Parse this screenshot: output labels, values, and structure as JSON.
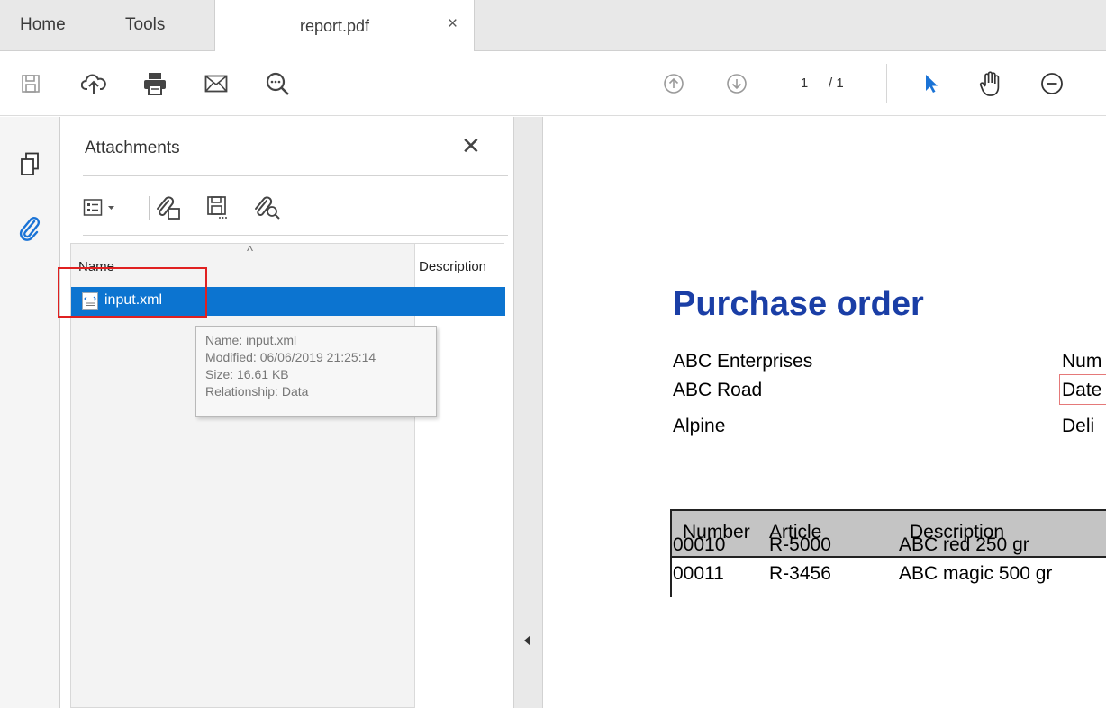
{
  "tabs": {
    "home": "Home",
    "tools": "Tools",
    "document": "report.pdf",
    "close": "×"
  },
  "toolbar": {
    "icons": [
      "save-icon",
      "cloud-upload-icon",
      "print-icon",
      "mail-icon",
      "zoom-search-icon",
      "page-up-icon",
      "page-down-icon",
      "select-arrow-icon",
      "hand-icon",
      "zoom-out-icon"
    ],
    "page_current": "1",
    "page_total": "/ 1",
    "accent_color": "#1a73d6"
  },
  "rail": {
    "icons": [
      "page-thumbnails-icon",
      "attachment-paperclip-icon"
    ]
  },
  "attachments": {
    "title": "Attachments",
    "close": "✕",
    "tools": [
      "options-icon",
      "add-attachment-icon",
      "save-attachment-icon",
      "search-attachment-icon"
    ],
    "columns": {
      "name": "Name",
      "description": "Description"
    },
    "rows": [
      {
        "name": "input.xml",
        "selected": true
      }
    ],
    "selection_color": "#0c74d0",
    "tooltip": {
      "name": "Name: input.xml",
      "modified": "Modified: 06/06/2019 21:25:14",
      "size": "Size: 16.61 KB",
      "relationship": "Relationship: Data"
    }
  },
  "document": {
    "title": "Purchase order",
    "title_color": "#1a3ea6",
    "address": [
      "ABC Enterprises",
      "ABC Road",
      "Alpine"
    ],
    "right_labels": [
      "Num",
      "Date",
      "Deli"
    ],
    "table": {
      "headers": [
        "Number",
        "Article",
        "Description"
      ],
      "rows": [
        [
          "00010",
          "R-5000",
          "ABC red 250 gr"
        ],
        [
          "00011",
          "R-3456",
          "ABC magic 500 gr"
        ]
      ]
    }
  }
}
